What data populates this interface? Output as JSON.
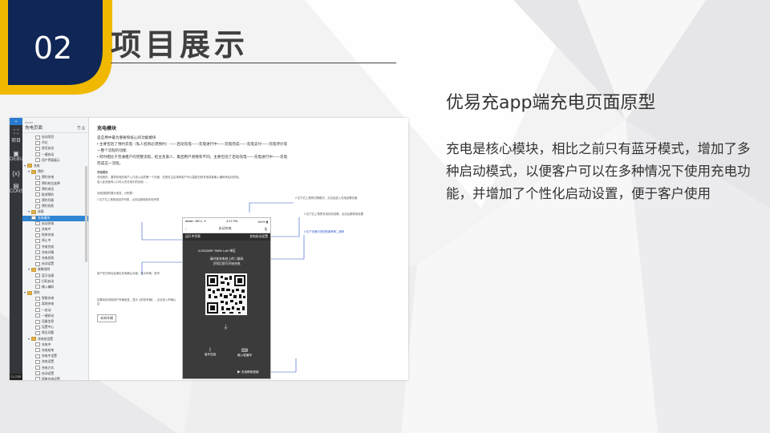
{
  "slide": {
    "number": "02",
    "title": "项目展示",
    "heading": "优易充app端充电页面原型",
    "description": "充电是核心模块，相比之前只有蓝牙模式，增加了多种启动模式，以便客户可以在多种情况下使用充电功能，并增加了个性化启动设置，便于客户使用",
    "colors": {
      "badge_navy": "#0f2656",
      "badge_yellow": "#f0b900",
      "text_dark": "#333333"
    }
  },
  "screenshot": {
    "sidebar_icons": [
      {
        "label": "",
        "icon": "menu-icon"
      },
      {
        "label": "项目",
        "icon": "org-chart-icon"
      },
      {
        "label": "DEBUG",
        "icon": "debug-icon"
      },
      {
        "label": "{x}",
        "icon": "variables-icon"
      },
      {
        "label": "CONSOLE",
        "icon": "console-icon"
      }
    ],
    "close_label": "CLOSE",
    "tree_header": {
      "small": "Axure",
      "name": "充电页面",
      "tools": "⎘ ⎙"
    },
    "tree_items": [
      {
        "label": "启动项目",
        "indent": 2,
        "kind": "page",
        "twisty": ""
      },
      {
        "label": "评论",
        "indent": 2,
        "kind": "page",
        "twisty": ""
      },
      {
        "label": "首页启动",
        "indent": 2,
        "kind": "page",
        "twisty": ""
      },
      {
        "label": "一键启动",
        "indent": 2,
        "kind": "page",
        "twisty": ""
      },
      {
        "label": "用户界面展示",
        "indent": 2,
        "kind": "page",
        "twisty": ""
      },
      {
        "label": "充电",
        "indent": 0,
        "kind": "folder",
        "twisty": "▾"
      },
      {
        "label": "预约",
        "indent": 1,
        "kind": "folder",
        "twisty": "▾"
      },
      {
        "label": "预约充电",
        "indent": 2,
        "kind": "page",
        "twisty": ""
      },
      {
        "label": "预约桩位选择",
        "indent": 2,
        "kind": "page",
        "twisty": ""
      },
      {
        "label": "预约成功",
        "indent": 2,
        "kind": "page",
        "twisty": ""
      },
      {
        "label": "取消预约",
        "indent": 2,
        "kind": "page",
        "twisty": ""
      },
      {
        "label": "预约列表",
        "indent": 2,
        "kind": "page",
        "twisty": ""
      },
      {
        "label": "预约失败",
        "indent": 2,
        "kind": "page",
        "twisty": ""
      },
      {
        "label": "连接",
        "indent": 1,
        "kind": "folder",
        "twisty": "▾"
      },
      {
        "label": "充电模块",
        "indent": 1,
        "kind": "page",
        "twisty": "▾",
        "selected": true
      },
      {
        "label": "启动充电",
        "indent": 2,
        "kind": "page",
        "twisty": ""
      },
      {
        "label": "充电中",
        "indent": 2,
        "kind": "page",
        "twisty": ""
      },
      {
        "label": "结束充电",
        "indent": 2,
        "kind": "page",
        "twisty": ""
      },
      {
        "label": "停止中",
        "indent": 2,
        "kind": "page",
        "twisty": ""
      },
      {
        "label": "充电完成",
        "indent": 2,
        "kind": "page",
        "twisty": ""
      },
      {
        "label": "充电详情",
        "indent": 2,
        "kind": "page",
        "twisty": ""
      },
      {
        "label": "充电失败",
        "indent": 2,
        "kind": "page",
        "twisty": ""
      },
      {
        "label": "启动设置",
        "indent": 2,
        "kind": "page",
        "twisty": ""
      },
      {
        "label": "故障说明",
        "indent": 1,
        "kind": "folder",
        "twisty": "▾"
      },
      {
        "label": "蓝牙连接",
        "indent": 2,
        "kind": "page",
        "twisty": ""
      },
      {
        "label": "扫码启动",
        "indent": 2,
        "kind": "page",
        "twisty": ""
      },
      {
        "label": "输入编码",
        "indent": 2,
        "kind": "page",
        "twisty": ""
      },
      {
        "label": "我的",
        "indent": 0,
        "kind": "folder",
        "twisty": "▾"
      },
      {
        "label": "智能充电",
        "indent": 2,
        "kind": "page",
        "twisty": ""
      },
      {
        "label": "离线充电",
        "indent": 2,
        "kind": "page",
        "twisty": ""
      },
      {
        "label": "一启动",
        "indent": 2,
        "kind": "page",
        "twisty": ""
      },
      {
        "label": "一键启动",
        "indent": 2,
        "kind": "page",
        "twisty": ""
      },
      {
        "label": "设备信息",
        "indent": 2,
        "kind": "page",
        "twisty": ""
      },
      {
        "label": "设置中心",
        "indent": 2,
        "kind": "page",
        "twisty": ""
      },
      {
        "label": "常见问题",
        "indent": 2,
        "kind": "page",
        "twisty": ""
      },
      {
        "label": "充电桩设置",
        "indent": 1,
        "kind": "folder",
        "twisty": "▾"
      },
      {
        "label": "充电中",
        "indent": 2,
        "kind": "page",
        "twisty": ""
      },
      {
        "label": "充电结束",
        "indent": 2,
        "kind": "page",
        "twisty": ""
      },
      {
        "label": "充电中设置",
        "indent": 2,
        "kind": "page",
        "twisty": ""
      },
      {
        "label": "充电设置",
        "indent": 2,
        "kind": "page",
        "twisty": ""
      },
      {
        "label": "充电方式",
        "indent": 2,
        "kind": "page",
        "twisty": ""
      },
      {
        "label": "启动设置",
        "indent": 2,
        "kind": "page",
        "twisty": ""
      },
      {
        "label": "智能充电设置",
        "indent": 2,
        "kind": "page",
        "twisty": ""
      }
    ],
    "doc": {
      "title": "充电模块",
      "bullets": [
        "是应用中最为重要和核心的功能模块",
        "• 主要包括了预约充电（私人桩则必须预约）——启动充电——充电进行中——充电完成——充电支付——充电评价等",
        "一整个流程的功能",
        "• 同时相比于普通租户的完整流程，桩主及家人、集团用户则略有不同，主要包括了启动充电——充电进行中——充电",
        "完成这一流程。"
      ],
      "notes": [
        {
          "text": "充电首页"
        },
        {
          "text": "充电首页，要求充电的用户入口进入后的第一个页面，在首页主区域有用户可以直接扫码充电或者输入编码来启动充电。"
        },
        {
          "text": "进入此页面有入口可以去充电中的页面……"
        },
        {
          "text": "页面顶部的展示信息，分别是："
        },
        {
          "text": "1 位于左上角的返回中列表，点击后跳转到充电列表"
        },
        {
          "text": "2 位于右上角的切换模式，点击后进入充电设置页面"
        },
        {
          "text": "3 位于右上角的充电状态设置，点击后跳转到设置"
        },
        {
          "text": "4 位于页面中央的桩编号和二维码"
        },
        {
          "text": "用户在扫码后会弹出充电确认页面，显示车辆、桩号"
        },
        {
          "text": "如果未检测到用户车辆信息，显示【未知车辆】，点击进入车辆认证"
        }
      ],
      "link_label": "未知车辆",
      "phone": {
        "status_left": "●●●●○ BELL ᯤ",
        "status_time": "4:21 PM",
        "status_right": "100% ▮",
        "nav_back": "‹",
        "nav_title": "启动充电",
        "tab_left": "运行中列表",
        "tab_right": "充电启动设置",
        "station_id": "A D5166EF  SMW Lot4  单区",
        "msg1": "请对准充电桩上的二维码",
        "msg2": "识别后即可开始充电",
        "btn_left": "蓝牙连接",
        "btn_right": "输入桩编号",
        "footer": "充电帮助视频"
      }
    }
  }
}
